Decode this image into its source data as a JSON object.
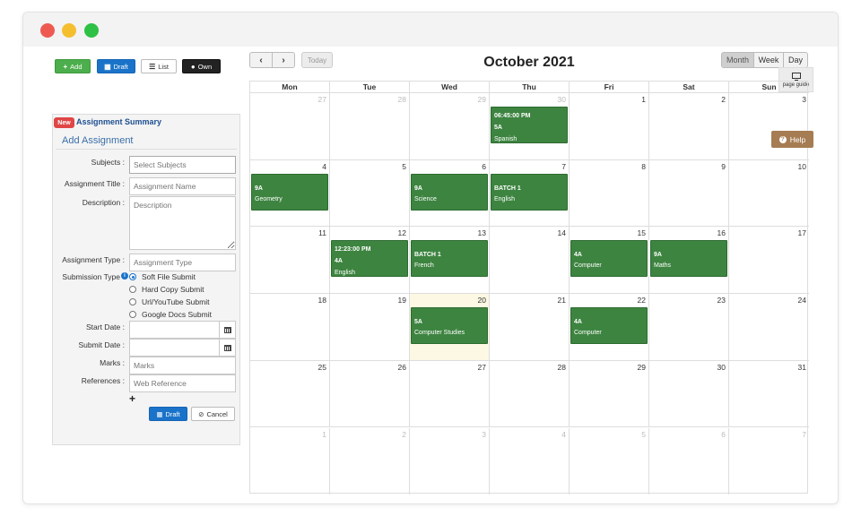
{
  "toolbar": {
    "add_label": "Add",
    "draft_label": "Draft",
    "list_label": "List",
    "own_label": "Own"
  },
  "form": {
    "badge": "New",
    "summary_link": "Assignment Summary",
    "title": "Add Assignment",
    "subjects_label": "Subjects :",
    "subjects_placeholder": "Select Subjects",
    "title_label": "Assignment Title :",
    "title_placeholder": "Assignment Name",
    "description_label": "Description :",
    "description_placeholder": "Description",
    "type_label": "Assignment Type :",
    "type_placeholder": "Assignment Type",
    "submission_label": "Submission Type",
    "submission_options": [
      "Soft File Submit",
      "Hard Copy Submit",
      "Url/YouTube Submit",
      "Google Docs Submit"
    ],
    "start_date_label": "Start Date :",
    "submit_date_label": "Submit Date :",
    "marks_label": "Marks :",
    "marks_placeholder": "Marks",
    "references_label": "References :",
    "references_placeholder": "Web Reference",
    "draft_button": "Draft",
    "cancel_button": "Cancel"
  },
  "calendar": {
    "today_label": "Today",
    "title": "October 2021",
    "views": [
      "Month",
      "Week",
      "Day"
    ],
    "page_guide_label": "page guide",
    "help_label": "Help",
    "weekdays": [
      "Mon",
      "Tue",
      "Wed",
      "Thu",
      "Fri",
      "Sat",
      "Sun"
    ],
    "weeks": [
      [
        "27",
        "28",
        "29",
        "30",
        "1",
        "2",
        "3"
      ],
      [
        "4",
        "5",
        "6",
        "7",
        "8",
        "9",
        "10"
      ],
      [
        "11",
        "12",
        "13",
        "14",
        "15",
        "16",
        "17"
      ],
      [
        "18",
        "19",
        "20",
        "21",
        "22",
        "23",
        "24"
      ],
      [
        "25",
        "26",
        "27",
        "28",
        "29",
        "30",
        "31"
      ],
      [
        "1",
        "2",
        "3",
        "4",
        "5",
        "6",
        "7"
      ]
    ],
    "events": {
      "w0_thu": {
        "time": "06:45:00 PM",
        "class": "5A",
        "subject": "Spanish"
      },
      "w1_mon": {
        "class": "9A",
        "subject": "Geometry"
      },
      "w1_wed": {
        "class": "9A",
        "subject": "Science"
      },
      "w1_thu": {
        "class": "BATCH 1",
        "subject": "English"
      },
      "w2_tue": {
        "time": "12:23:00 PM",
        "class": "4A",
        "subject": "English"
      },
      "w2_wed": {
        "class": "BATCH 1",
        "subject": "French"
      },
      "w2_fri": {
        "class": "4A",
        "subject": "Computer"
      },
      "w2_sat": {
        "class": "9A",
        "subject": "Maths"
      },
      "w3_wed": {
        "class": "5A",
        "subject": "Computer Studies"
      },
      "w3_fri": {
        "class": "4A",
        "subject": "Computer"
      }
    }
  }
}
